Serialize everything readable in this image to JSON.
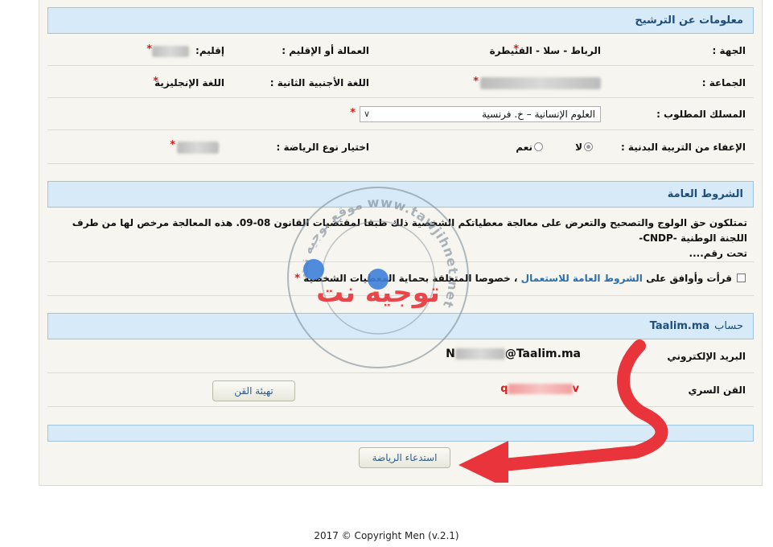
{
  "candidacy": {
    "title": "معلومات عن الترشيح",
    "region_label": "الجهة :",
    "region_value": "الرباط - سلا - القنيطرة",
    "prefecture_label": "العمالة أو الإقليم :",
    "province_label": "إقليم:",
    "commune_label": "الجماعة :",
    "second_lang_label": "اللغة الأجنبية الثانية :",
    "second_lang_value": "اللغة الإنجليزية",
    "track_label": "المسلك المطلوب :",
    "track_selected": "العلوم الإنسانية – خ. فرنسية",
    "pe_exempt_label": "الإعفاء من التربية البدنية :",
    "pe_no": "لا",
    "pe_yes": "نعم",
    "sport_type_label": "اختيار نوع الرياضة :",
    "required_mark": "*"
  },
  "terms": {
    "title": "الشروط العامة",
    "text_line1": "تمتلكون حق الولوج والتصحيح والتعرض على معالجة معطياتكم الشخصية ذلك طبقا لمقتضيات القانون 08-09. هذه المعالجة مرخص لها من طرف اللجنة الوطنية -CNDP-",
    "text_line2": "تحت رقم....",
    "agree_prefix": "قرأت وأوافق على",
    "agree_link": "الشروط العامة للاستعمال",
    "agree_suffix": "، خصوصا المتعلقة بحماية المعطيات الشخصية"
  },
  "account": {
    "title_brand": "Taalim.ma",
    "title_word": "حساب",
    "email_label": "البريد الإلكتروني",
    "email_prefix": "N",
    "email_suffix": "@Taalim.ma",
    "password_label": "القن السري",
    "password_start": "q",
    "password_end": "v",
    "reset_button": "تهيئة القن"
  },
  "actions": {
    "summon_button": "استدعاء الرياضة"
  },
  "watermark": {
    "brand": "توجيه نت",
    "ring_text": "موقع توجيه نت www.tawjihnet.net"
  },
  "footer": {
    "copyright": "2017 © Copyright Men (v.2.1)"
  },
  "colors": {
    "header_bg": "#d7eaf8",
    "header_text": "#1f4e7a",
    "required": "#d21f1f",
    "arrow": "#e8343a",
    "watermark": "#6b7c8c"
  }
}
